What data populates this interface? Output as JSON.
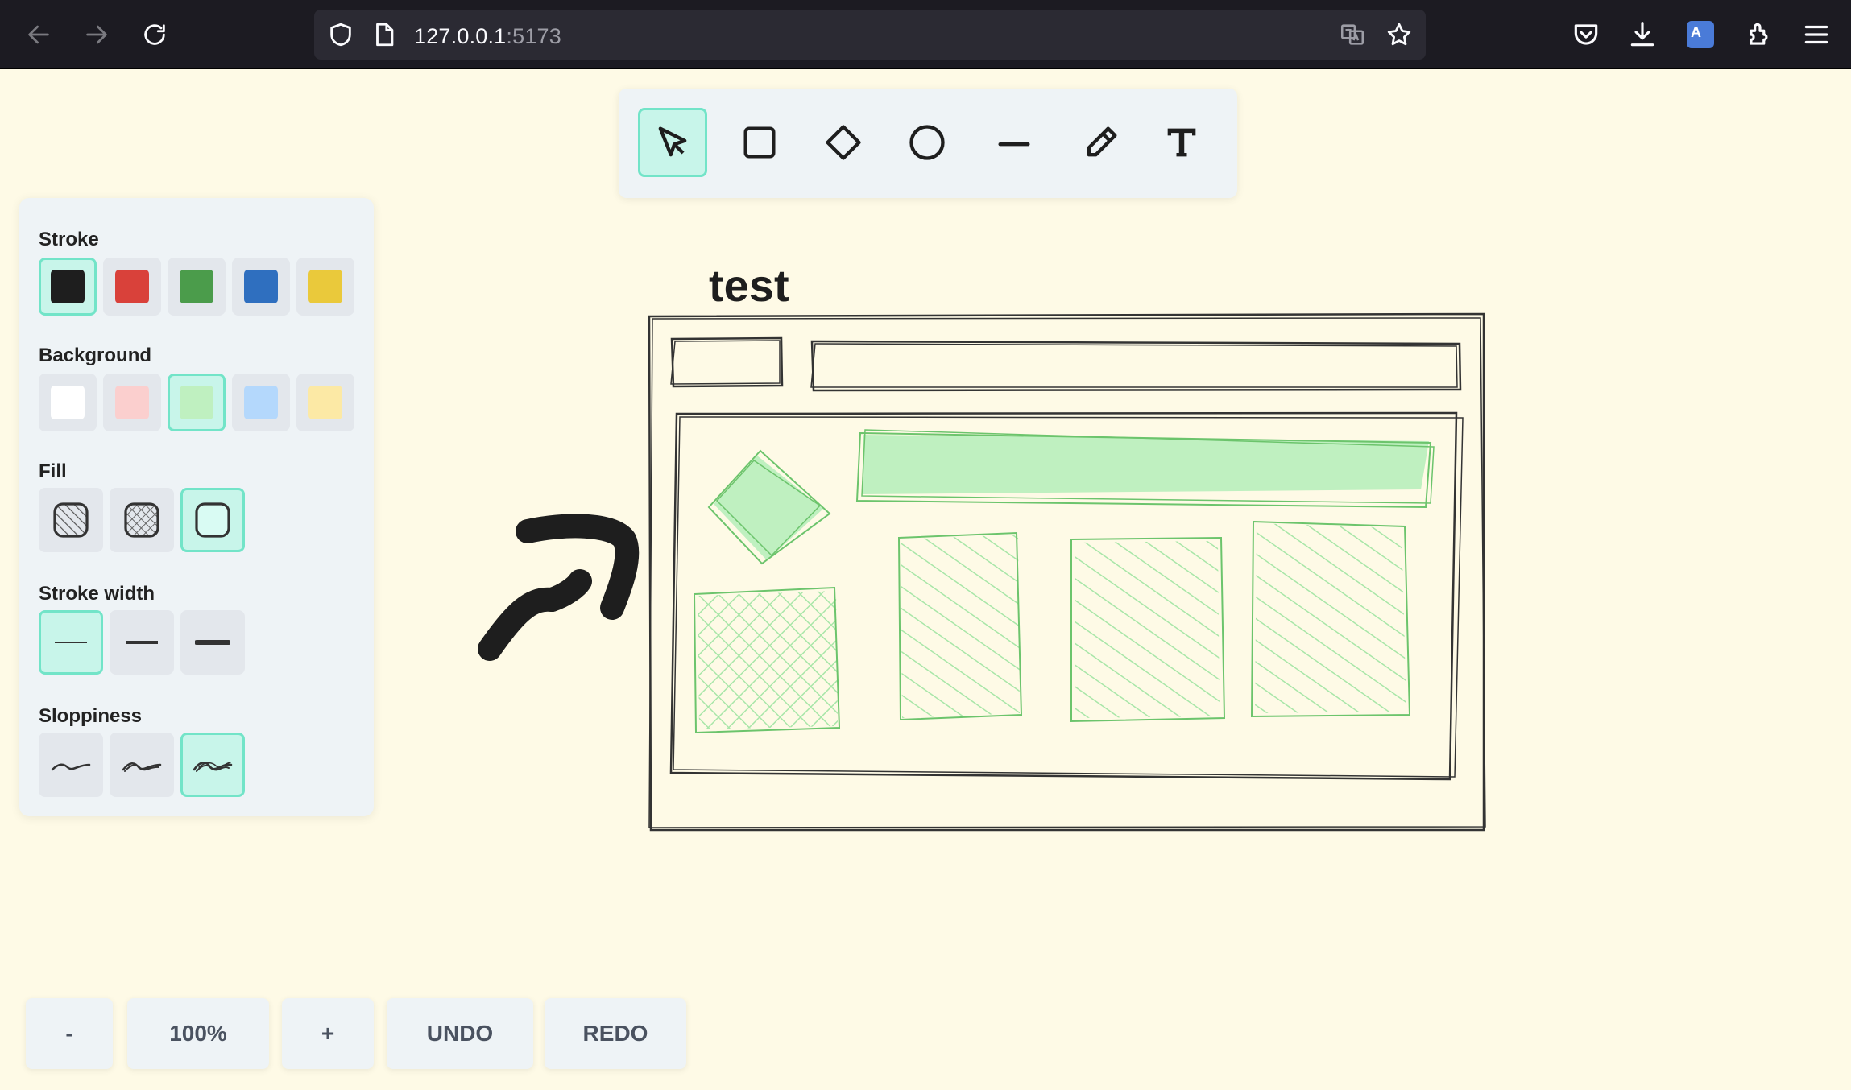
{
  "browser": {
    "url_host": "127.0.0.1",
    "url_port": ":5173"
  },
  "toolbar": {
    "tools": [
      {
        "name": "select",
        "icon": "cursor-icon",
        "active": true
      },
      {
        "name": "rectangle",
        "icon": "square-icon",
        "active": false
      },
      {
        "name": "diamond",
        "icon": "diamond-icon",
        "active": false
      },
      {
        "name": "ellipse",
        "icon": "circle-icon",
        "active": false
      },
      {
        "name": "line",
        "icon": "line-icon",
        "active": false
      },
      {
        "name": "pencil",
        "icon": "pencil-icon",
        "active": false
      },
      {
        "name": "text",
        "icon": "text-icon",
        "active": false
      }
    ]
  },
  "panel": {
    "stroke_label": "Stroke",
    "stroke_colors": [
      "#1e1e1e",
      "#d9413a",
      "#4b9c4b",
      "#2f6fbf",
      "#eac93b"
    ],
    "stroke_selected": 0,
    "background_label": "Background",
    "background_colors": [
      "#ffffff",
      "#fbcfce",
      "#bff0c0",
      "#b4d8fc",
      "#fce9a5"
    ],
    "background_selected": 2,
    "fill_label": "Fill",
    "fill_options": [
      "hachure",
      "cross-hatch",
      "solid"
    ],
    "fill_selected": 2,
    "stroke_width_label": "Stroke width",
    "stroke_width_options": [
      "thin",
      "bold",
      "extra-bold"
    ],
    "stroke_width_selected": 0,
    "sloppiness_label": "Sloppiness",
    "sloppiness_options": [
      "architect",
      "artist",
      "cartoonist"
    ],
    "sloppiness_selected": 2
  },
  "canvas": {
    "text_label": "test",
    "accent_color": "#a8e6a8"
  },
  "controls": {
    "zoom_out": "-",
    "zoom_level": "100%",
    "zoom_in": "+",
    "undo": "UNDO",
    "redo": "REDO"
  }
}
